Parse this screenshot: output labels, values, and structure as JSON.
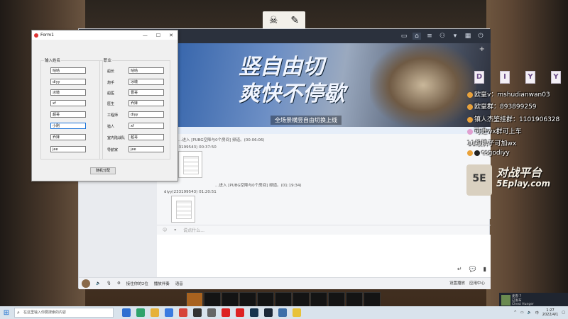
{
  "streamer_logo": {
    "icon1": "pirate-skull-icon",
    "icon2": "feather-icon"
  },
  "app": {
    "topbar_icons": [
      "screen-share-icon",
      "home-icon",
      "list-icon",
      "gamepad-icon",
      "shirt-icon",
      "grid-icon",
      "power-icon"
    ],
    "banner": {
      "line1": "竖自由切",
      "line2": "爽快不停歇",
      "subtitle": "全场景横竖自由切换上线"
    },
    "chat": {
      "msg1": "…进入 [PUBG空降与0个房间] 频道。(00:06:06)",
      "msg2_user": "diyy(233199543)",
      "msg2_time": "00:37:50",
      "msg3": "…进入 [PUBG空降与0个房间] 频道。(01:19:34)",
      "msg4_user": "diyy(233199543)",
      "msg4_time": "01:20:51"
    },
    "input_placeholder": "说点什么...",
    "input_toolbar": [
      "表情",
      "更多"
    ],
    "bottom_bar": [
      "接住你的2位",
      "播放伴奏",
      "语音"
    ],
    "bottom_right": [
      "设置播放",
      "应用中心"
    ]
  },
  "form": {
    "title": "Form1",
    "group_names_label": "输入姓名",
    "group_roles_label": "职业",
    "names": [
      "咕咕",
      "diyy",
      "冰墩",
      "xf",
      "超哥",
      "小刚",
      "乔妹",
      "jee"
    ],
    "roles": [
      {
        "label": "船长",
        "value": "咕咕"
      },
      {
        "label": "炮手",
        "value": "冰墩"
      },
      {
        "label": "船医",
        "value": "晋哥"
      },
      {
        "label": "医生",
        "value": "乔妹"
      },
      {
        "label": "工程师",
        "value": "diyy"
      },
      {
        "label": "猎人",
        "value": "xf"
      },
      {
        "label": "室内陆战队",
        "value": "超哥"
      },
      {
        "label": "导航家",
        "value": "jee"
      }
    ],
    "button": "随机分配"
  },
  "overlay": {
    "letters": [
      "D",
      "I",
      "Y",
      "Y"
    ],
    "lines": [
      "欧皇v：mshudianwan03",
      "欧皇群：893899259",
      "镇人杰鉴挂群：1101906328",
      "可进wx群可上车",
      "11级牌子可加wx",
      "csgodiyy"
    ],
    "logo_badge": "5E",
    "logo_text1": "对战平台",
    "logo_text2": "5Eplay.com"
  },
  "notification": {
    "title": "麦客·7",
    "line2": "已发布",
    "line3": "Chest Hunger"
  },
  "taskbar": {
    "search_placeholder": "在这里输入你要搜索的内容",
    "time": "1:27",
    "date": "2022/4/1"
  }
}
